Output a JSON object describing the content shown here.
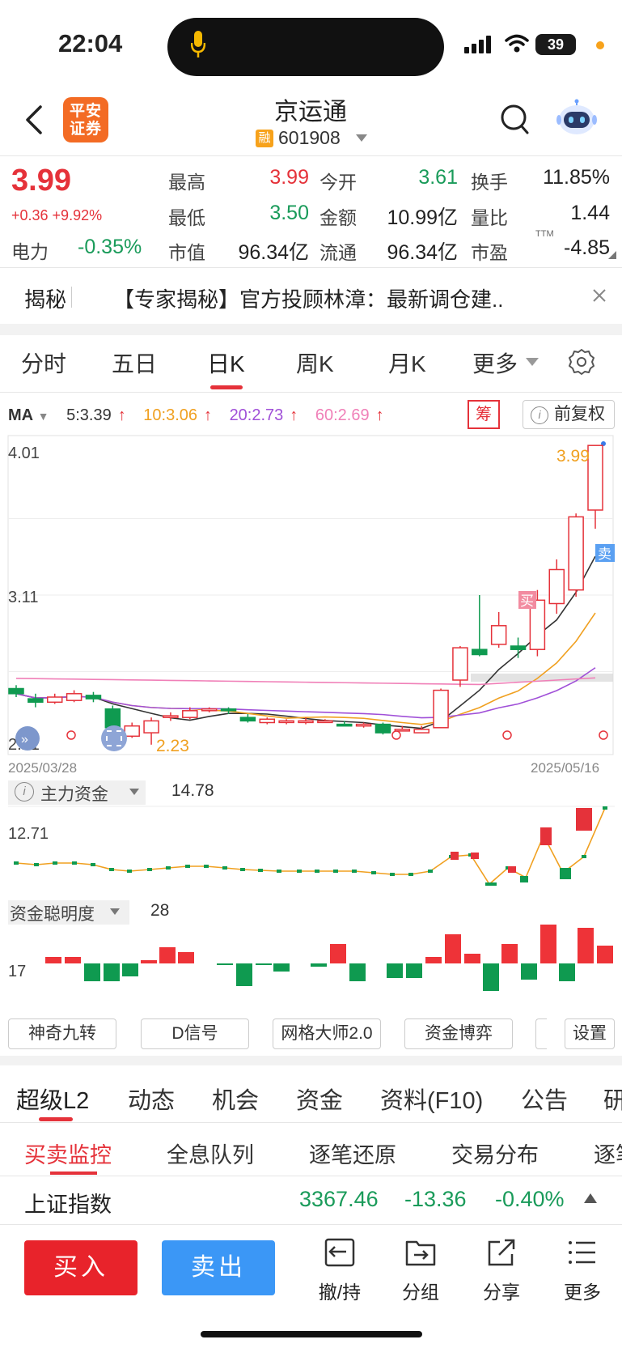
{
  "status_bar": {
    "time": "22:04",
    "battery": "39"
  },
  "header": {
    "title": "京运通",
    "code": "601908",
    "broker_logo": [
      "平安",
      "证券"
    ],
    "rong_badge": "融"
  },
  "quote": {
    "price": "3.99",
    "change": "+0.36 +9.92%",
    "sector_label": "电力",
    "sector_change": "-0.35%",
    "fields": [
      {
        "label": "最高",
        "value": "3.99",
        "color": "#e5323a"
      },
      {
        "label": "今开",
        "value": "3.61",
        "color": "#1a9b5a"
      },
      {
        "label": "换手",
        "value": "11.85%",
        "color": "#222222"
      },
      {
        "label": "最低",
        "value": "3.50",
        "color": "#1a9b5a"
      },
      {
        "label": "金额",
        "value": "10.99亿",
        "color": "#222222"
      },
      {
        "label": "量比",
        "value": "1.44",
        "color": "#222222"
      },
      {
        "label": "市值",
        "value": "96.34亿",
        "color": "#222222"
      },
      {
        "label": "流通",
        "value": "96.34亿",
        "color": "#222222"
      },
      {
        "label": "市盈",
        "value": "-4.85",
        "color": "#222222"
      }
    ],
    "ttm": "TTM"
  },
  "news": {
    "label": "揭秘",
    "text": "【专家揭秘】官方投顾林漳：最新调仓建.."
  },
  "period_tabs": [
    "分时",
    "五日",
    "日K",
    "周K",
    "月K",
    "更多"
  ],
  "ma": {
    "label": "MA",
    "items": [
      {
        "text": "5:3.39",
        "color": "#333333"
      },
      {
        "text": "10:3.06",
        "color": "#f0a020"
      },
      {
        "text": "20:2.73",
        "color": "#a050d8"
      },
      {
        "text": "60:2.69",
        "color": "#f080b8"
      }
    ],
    "arrow": "↑",
    "chou": "筹",
    "adjust": "前复权",
    "info": "i"
  },
  "kline": {
    "y_top": "4.01",
    "y_mid": "3.11",
    "y_bot": "2.21",
    "low_label": "2.23",
    "high_label": "3.99",
    "date_start": "2025/03/28",
    "date_end": "2025/05/16",
    "buy_marker": "买",
    "sell_marker": "卖"
  },
  "chart_data": [
    {
      "type": "candlestick",
      "x": [
        "2025/03/28",
        "2025/05/16"
      ],
      "ylim": [
        2.21,
        4.01
      ],
      "candles": [
        {
          "o": 2.56,
          "c": 2.53,
          "h": 2.58,
          "l": 2.51
        },
        {
          "o": 2.5,
          "c": 2.48,
          "h": 2.53,
          "l": 2.45
        },
        {
          "o": 2.48,
          "c": 2.51,
          "h": 2.53,
          "l": 2.47
        },
        {
          "o": 2.49,
          "c": 2.53,
          "h": 2.55,
          "l": 2.48
        },
        {
          "o": 2.52,
          "c": 2.5,
          "h": 2.54,
          "l": 2.48
        },
        {
          "o": 2.44,
          "c": 2.33,
          "h": 2.46,
          "l": 2.31
        },
        {
          "o": 2.28,
          "c": 2.34,
          "h": 2.36,
          "l": 2.27
        },
        {
          "o": 2.3,
          "c": 2.37,
          "h": 2.39,
          "l": 2.23
        },
        {
          "o": 2.39,
          "c": 2.4,
          "h": 2.42,
          "l": 2.37
        },
        {
          "o": 2.39,
          "c": 2.43,
          "h": 2.45,
          "l": 2.38
        },
        {
          "o": 2.43,
          "c": 2.44,
          "h": 2.45,
          "l": 2.42
        },
        {
          "o": 2.44,
          "c": 2.43,
          "h": 2.45,
          "l": 2.41
        },
        {
          "o": 2.39,
          "c": 2.37,
          "h": 2.41,
          "l": 2.36
        },
        {
          "o": 2.36,
          "c": 2.38,
          "h": 2.39,
          "l": 2.35
        },
        {
          "o": 2.37,
          "c": 2.37,
          "h": 2.38,
          "l": 2.35
        },
        {
          "o": 2.37,
          "c": 2.37,
          "h": 2.39,
          "l": 2.35
        },
        {
          "o": 2.37,
          "c": 2.37,
          "h": 2.38,
          "l": 2.36
        },
        {
          "o": 2.35,
          "c": 2.34,
          "h": 2.37,
          "l": 2.34
        },
        {
          "o": 2.34,
          "c": 2.35,
          "h": 2.36,
          "l": 2.33
        },
        {
          "o": 2.35,
          "c": 2.3,
          "h": 2.36,
          "l": 2.29
        },
        {
          "o": 2.32,
          "c": 2.32,
          "h": 2.34,
          "l": 2.31
        },
        {
          "o": 2.3,
          "c": 2.32,
          "h": 2.34,
          "l": 2.3
        },
        {
          "o": 2.33,
          "c": 2.55,
          "h": 2.56,
          "l": 2.33
        },
        {
          "o": 2.61,
          "c": 2.8,
          "h": 2.81,
          "l": 2.57
        },
        {
          "o": 2.79,
          "c": 2.76,
          "h": 3.11,
          "l": 2.75
        },
        {
          "o": 2.82,
          "c": 2.93,
          "h": 3.01,
          "l": 2.8
        },
        {
          "o": 2.81,
          "c": 2.79,
          "h": 2.86,
          "l": 2.74
        },
        {
          "o": 2.79,
          "c": 3.08,
          "h": 3.14,
          "l": 2.75
        },
        {
          "o": 3.06,
          "c": 3.26,
          "h": 3.32,
          "l": 3.0
        },
        {
          "o": 3.14,
          "c": 3.57,
          "h": 3.59,
          "l": 3.1
        },
        {
          "o": 3.61,
          "c": 3.99,
          "h": 3.99,
          "l": 3.5
        }
      ]
    },
    {
      "type": "line+bar",
      "title": "主力资金",
      "value": "14.78",
      "ytick": "12.71"
    },
    {
      "type": "bar",
      "title": "资金聪明度",
      "value": "28",
      "ytick": "17"
    }
  ],
  "fund": {
    "title": "主力资金",
    "value": "14.78",
    "ytick": "12.71"
  },
  "smart": {
    "title": "资金聪明度",
    "value": "28",
    "ytick": "17"
  },
  "indicator_buttons": [
    "神奇九转",
    "D信号",
    "网格大师2.0",
    "资金博弈",
    "设置"
  ],
  "section_tabs": [
    "超级L2",
    "动态",
    "机会",
    "资金",
    "资料(F10)",
    "公告",
    "研"
  ],
  "sub_tabs": [
    "买卖监控",
    "全息队列",
    "逐笔还原",
    "交易分布",
    "逐笔"
  ],
  "index": {
    "name": "上证指数",
    "value": "3367.46",
    "change": "-13.36",
    "pct": "-0.40%"
  },
  "bottom_bar": {
    "buy": "买入",
    "sell": "卖出",
    "tools": [
      "撤/持",
      "分组",
      "分享",
      "更多"
    ]
  }
}
